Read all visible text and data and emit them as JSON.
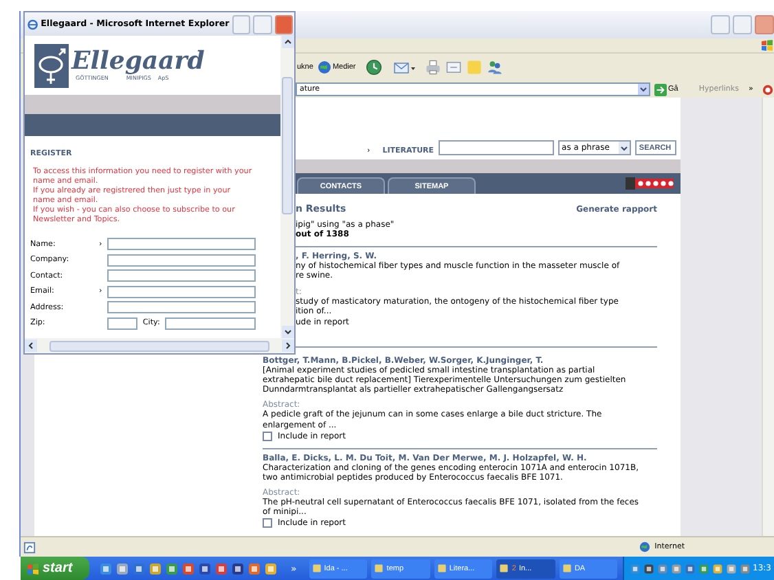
{
  "popup": {
    "title": "Ellegaard - Microsoft Internet Explorer",
    "logo": {
      "name": "Ellegaard",
      "place": "GÖTTINGEN",
      "product": "MINIPIGS",
      "suffix": "ApS"
    },
    "heading": "REGISTER",
    "notes": [
      "To access this information you need to register with your\nname and email.",
      "If you already are registrered then just type in your\nname and email.",
      "If you wish - you can also choose to subscribe to our\nNewsletter and Topics."
    ],
    "fields": [
      {
        "label": "Name:",
        "marker": "›"
      },
      {
        "label": "Company:"
      },
      {
        "label": "Contact:"
      },
      {
        "label": "Email:",
        "marker": "›"
      },
      {
        "label": "Address:"
      }
    ],
    "zip": {
      "label": "Zip:"
    },
    "city": {
      "label": "City:"
    }
  },
  "main": {
    "toolbar": [
      "ukne",
      "Medier"
    ],
    "address": "ature",
    "go": "Gå",
    "links": "Hyperlinks",
    "more": "»",
    "search": {
      "marker": "›",
      "label": "LITERATURE",
      "mode": "as a phrase",
      "button": "SEARCH"
    },
    "tabs": [
      {
        "label": "CONTACTS",
        "selected": false
      },
      {
        "label": "SITEMAP",
        "selected": false
      }
    ],
    "results": {
      "title": "n Results",
      "report": "Generate rapport",
      "query": "ipig\" using \"as a phase\"",
      "count": "out of 1388"
    },
    "entries": [
      {
        "kind": "clipped",
        "authors": ", F. Herring, S. W.",
        "title": "ny of histochemical fiber types and muscle function in the masseter muscle of\nre swine.",
        "abstract_label": "t:",
        "abstract": "study of masticatory maturation, the ontogeny of the histochemical fiber type\nition of...",
        "include": "ude in report"
      },
      {
        "kind": "full",
        "authors": "Bottger, T.Mann, B.Pickel, B.Weber, W.Sorger, K.Junginger, T.",
        "title": "[Animal experiment studies of pedicled small intestine transplantation as partial\nextrahepatic bile duct replacement] Tierexperimentelle Untersuchungen zum gestielten\nDunndarmtransplantat als partieller extrahepatischer Gallengangsersatz",
        "abstract_label": "Abstract:",
        "abstract": "A pedicle graft of the jejunum can in some cases enlarge a bile duct stricture. The\nenlargement of ...",
        "include": "Include in report",
        "checked": false
      },
      {
        "kind": "full",
        "authors": "Balla, E. Dicks, L. M. Du Toit, M. Van Der Merwe, M. J. Holzapfel, W. H.",
        "title": "Characterization and cloning of the genes encoding enterocin 1071A and enterocin 1071B,\ntwo antimicrobial peptides produced by Enterococcus faecalis BFE 1071.",
        "abstract_label": "Abstract:",
        "abstract": "The pH-neutral cell supernatant of Enterococcus faecalis BFE 1071, isolated from the feces\nof minipi...",
        "include": "Include in report",
        "checked": false
      }
    ],
    "status": "Internet"
  },
  "taskbar": {
    "start": "start",
    "more": "»",
    "tasks": [
      {
        "label": "Ida - ...",
        "selected": false
      },
      {
        "label": "temp",
        "selected": false
      },
      {
        "label": "Litera...",
        "selected": false
      },
      {
        "count": "2",
        "label": "In...",
        "selected": true
      },
      {
        "label": "DA",
        "selected": false
      }
    ],
    "clock": "13:3"
  }
}
